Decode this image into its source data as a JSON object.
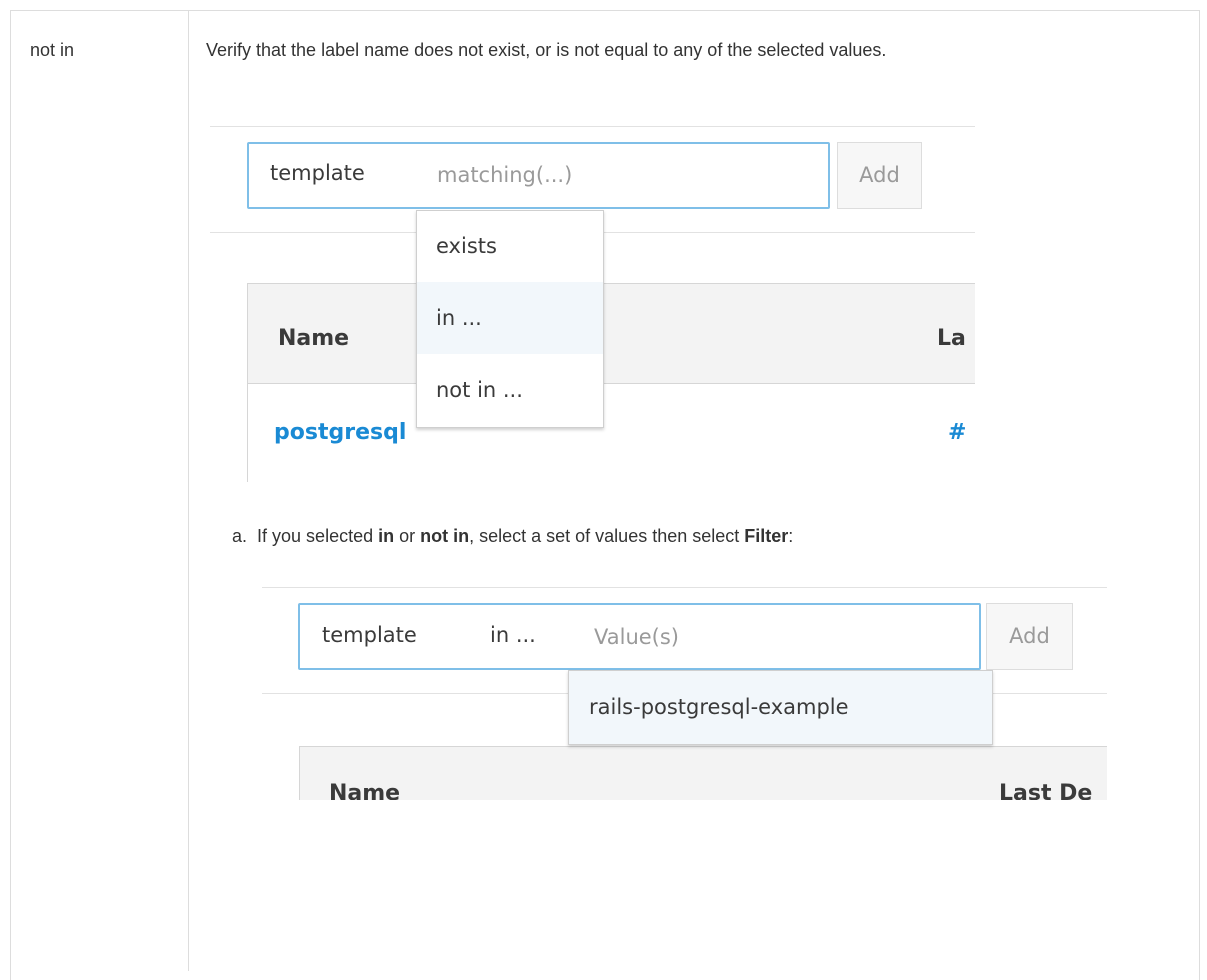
{
  "row": {
    "operator": "not in",
    "description": "Verify that the label name does not exist, or is not equal to any of the selected values."
  },
  "screenshot1": {
    "filter": {
      "key": "template",
      "placeholder": "matching(...)",
      "add_label": "Add"
    },
    "dropdown": [
      "exists",
      "in ...",
      "not in ..."
    ],
    "table": {
      "col_name": "Name",
      "col_partial": "La",
      "row_name": "postgresql",
      "row_partial": "#"
    }
  },
  "step": {
    "marker": "a.",
    "pre": "If you selected ",
    "in": "in",
    "or": " or ",
    "not_in": "not in",
    "mid": ", select a set of values then select ",
    "filter": "Filter",
    "end": ":"
  },
  "screenshot2": {
    "filter": {
      "key": "template",
      "operator": "in ...",
      "placeholder": "Value(s)",
      "add_label": "Add"
    },
    "suggestion": "rails-postgresql-example",
    "table": {
      "col_name": "Name",
      "col_partial": "Last De"
    }
  },
  "colors": {
    "link": "#1a8ad4",
    "focus_border": "#7fbfe8",
    "border": "#dddddd"
  }
}
